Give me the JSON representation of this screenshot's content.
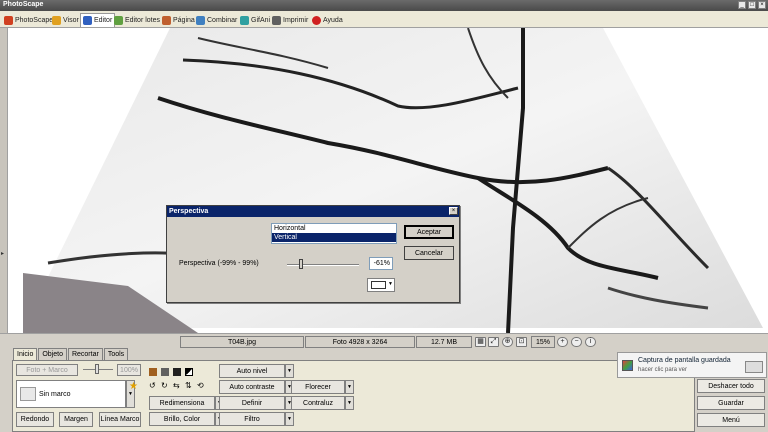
{
  "window": {
    "title": "PhotoScape"
  },
  "tabs": [
    {
      "label": "PhotoScape",
      "icon": "photoscape-icon",
      "color": "#d04020"
    },
    {
      "label": "Visor",
      "icon": "viewer-icon",
      "color": "#e0a020"
    },
    {
      "label": "Editor",
      "icon": "editor-icon",
      "color": "#3060c0"
    },
    {
      "label": "Editor lotes",
      "icon": "batch-editor-icon",
      "color": "#60a040"
    },
    {
      "label": "Página",
      "icon": "page-icon",
      "color": "#c06030"
    },
    {
      "label": "Combinar",
      "icon": "combine-icon",
      "color": "#4080c0"
    },
    {
      "label": "GifAni",
      "icon": "gif-icon",
      "color": "#30a0a0"
    },
    {
      "label": "Imprimir",
      "icon": "printer-icon",
      "color": "#606060"
    },
    {
      "label": "Ayuda",
      "icon": "help-icon",
      "color": "#d02020"
    }
  ],
  "status": {
    "filename": "T04B.jpg",
    "dimensions": "Foto 4928 x 3264",
    "memory": "12.7 MB",
    "zoom": "15%"
  },
  "lower_tabs": [
    "Inicio",
    "Objeto",
    "Recortar",
    "Tools"
  ],
  "editor_panel": {
    "photo_frame_btn": "Foto + Marco",
    "zoom_value": "100%",
    "frame_select": "Sin marco",
    "redondo": "Redondo",
    "margen": "Margen",
    "linea_marco": "Línea Marco",
    "redimensiona": "Redimensiona",
    "brillo_color": "Brillo, Color",
    "auto_nivel": "Auto nivel",
    "auto_contraste": "Auto contraste",
    "definir": "Definir",
    "filtro": "Filtro",
    "florecer": "Florecer",
    "contraluz": "Contraluz"
  },
  "right_buttons": {
    "undo_all": "Deshacer todo",
    "save": "Guardar",
    "menu": "Menú"
  },
  "toast": {
    "title": "Captura de pantalla guardada",
    "subtitle": "hacer clic para ver"
  },
  "dialog": {
    "title": "Perspectiva",
    "options": [
      "Horizontal",
      "Vertical"
    ],
    "selected_index": 1,
    "accept": "Aceptar",
    "cancel": "Cancelar",
    "slider_label": "Perspectiva (-99% - 99%)",
    "value": "-61%",
    "slider_fraction": 0.2,
    "color": "#ffffff"
  }
}
